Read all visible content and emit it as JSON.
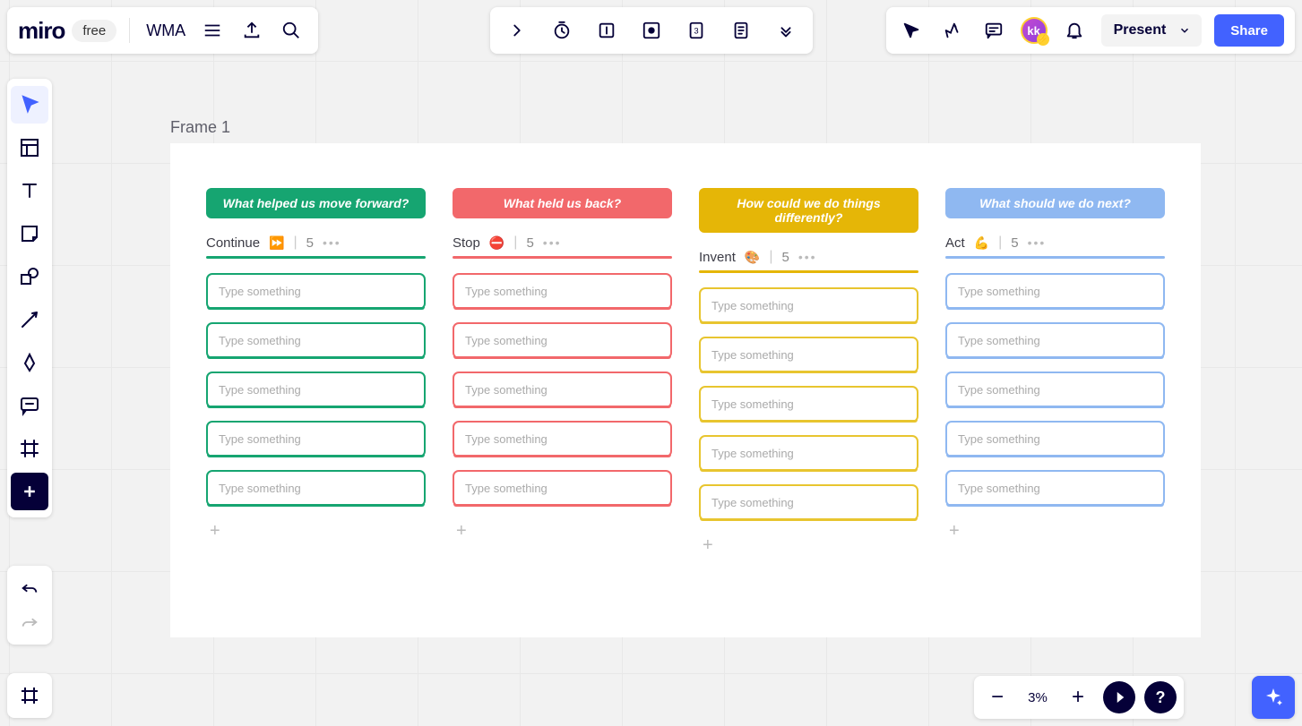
{
  "app": {
    "logo": "miro",
    "plan": "free",
    "board_name": "WMA"
  },
  "top_right": {
    "avatar_initials": "kk",
    "present_label": "Present",
    "share_label": "Share"
  },
  "zoom": {
    "level": "3%"
  },
  "frame": {
    "label": "Frame 1"
  },
  "columns": [
    {
      "header": "What helped us move forward?",
      "name": "Continue",
      "emoji": "⏩",
      "count": "5",
      "placeholder": "Type something",
      "cards": [
        "Type something",
        "Type something",
        "Type something",
        "Type something",
        "Type something"
      ]
    },
    {
      "header": "What held us back?",
      "name": "Stop",
      "emoji": "⛔",
      "count": "5",
      "placeholder": "Type something",
      "cards": [
        "Type something",
        "Type something",
        "Type something",
        "Type something",
        "Type something"
      ]
    },
    {
      "header": "How could we do things differently?",
      "name": "Invent",
      "emoji": "🎨",
      "count": "5",
      "placeholder": "Type something",
      "cards": [
        "Type something",
        "Type something",
        "Type something",
        "Type something",
        "Type something"
      ]
    },
    {
      "header": "What should we do next?",
      "name": "Act",
      "emoji": "💪",
      "count": "5",
      "placeholder": "Type something",
      "cards": [
        "Type something",
        "Type something",
        "Type something",
        "Type something",
        "Type something"
      ]
    }
  ]
}
